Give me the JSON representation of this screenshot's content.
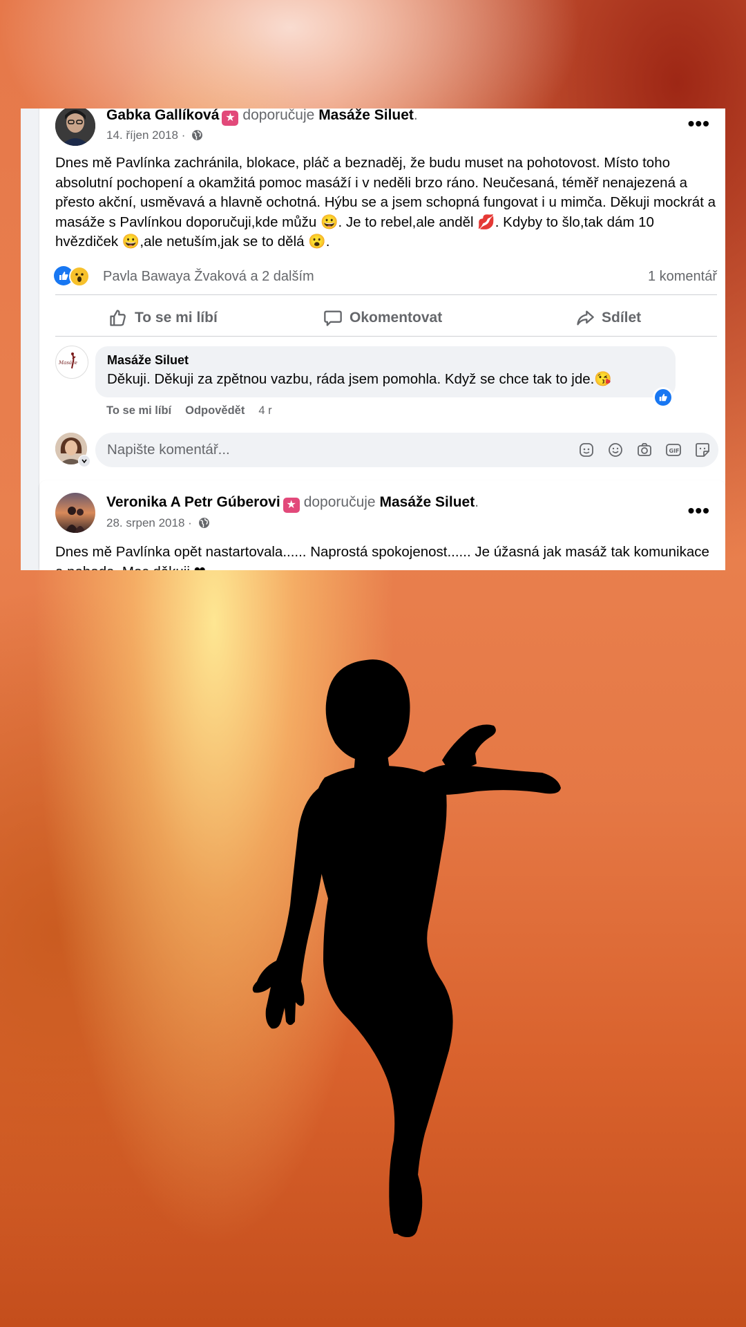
{
  "post1": {
    "author": "Gabka Gallíková",
    "recommends": "doporučuje",
    "page": "Masáže Siluet",
    "date": "14. říjen 2018 ·",
    "text": "Dnes mě Pavlínka zachránila, blokace, pláč a beznaděj, že budu muset na pohotovost. Místo toho absolutní pochopení a okamžitá pomoc masáží i v neděli brzo ráno. Neučesaná, téměř nenajezená a přesto akční, usměvavá a hlavně ochotná. Hýbu se a jsem schopná fungovat i u mimča. Děkuji mockrát a masáže s Pavlínkou doporučuji,kde můžu 😀. Je to rebel,ale anděl 💋. Kdyby to šlo,tak dám 10 hvězdiček 😀,ale netuším,jak se to dělá 😮.",
    "reactions_text": "Pavla Bawaya Žvaková a 2 dalším",
    "comment_count": "1 komentář",
    "actions": {
      "like": "To se mi líbí",
      "comment": "Okomentovat",
      "share": "Sdílet"
    },
    "comment": {
      "author": "Masáže Siluet",
      "text": "Děkuji. Děkuji za zpětnou vazbu, ráda jsem pomohla. Když se chce tak to jde.😘",
      "like": "To se mi líbí",
      "reply": "Odpovědět",
      "age": "4 r"
    },
    "input_placeholder": "Napište komentář..."
  },
  "post2": {
    "author": "Veronika A Petr Gúberovi",
    "recommends": "doporučuje",
    "page": "Masáže Siluet",
    "date": "28. srpen 2018 ·",
    "text": "Dnes mě Pavlínka opět nastartovala...... Naprostá spokojenost...... Je úžasná jak masáž tak komunikace a pohoda. Moc děkuji ❤"
  },
  "colors": {
    "fb_blue": "#1877f2",
    "badge_pink": "#e2497a",
    "text_secondary": "#65676b"
  }
}
